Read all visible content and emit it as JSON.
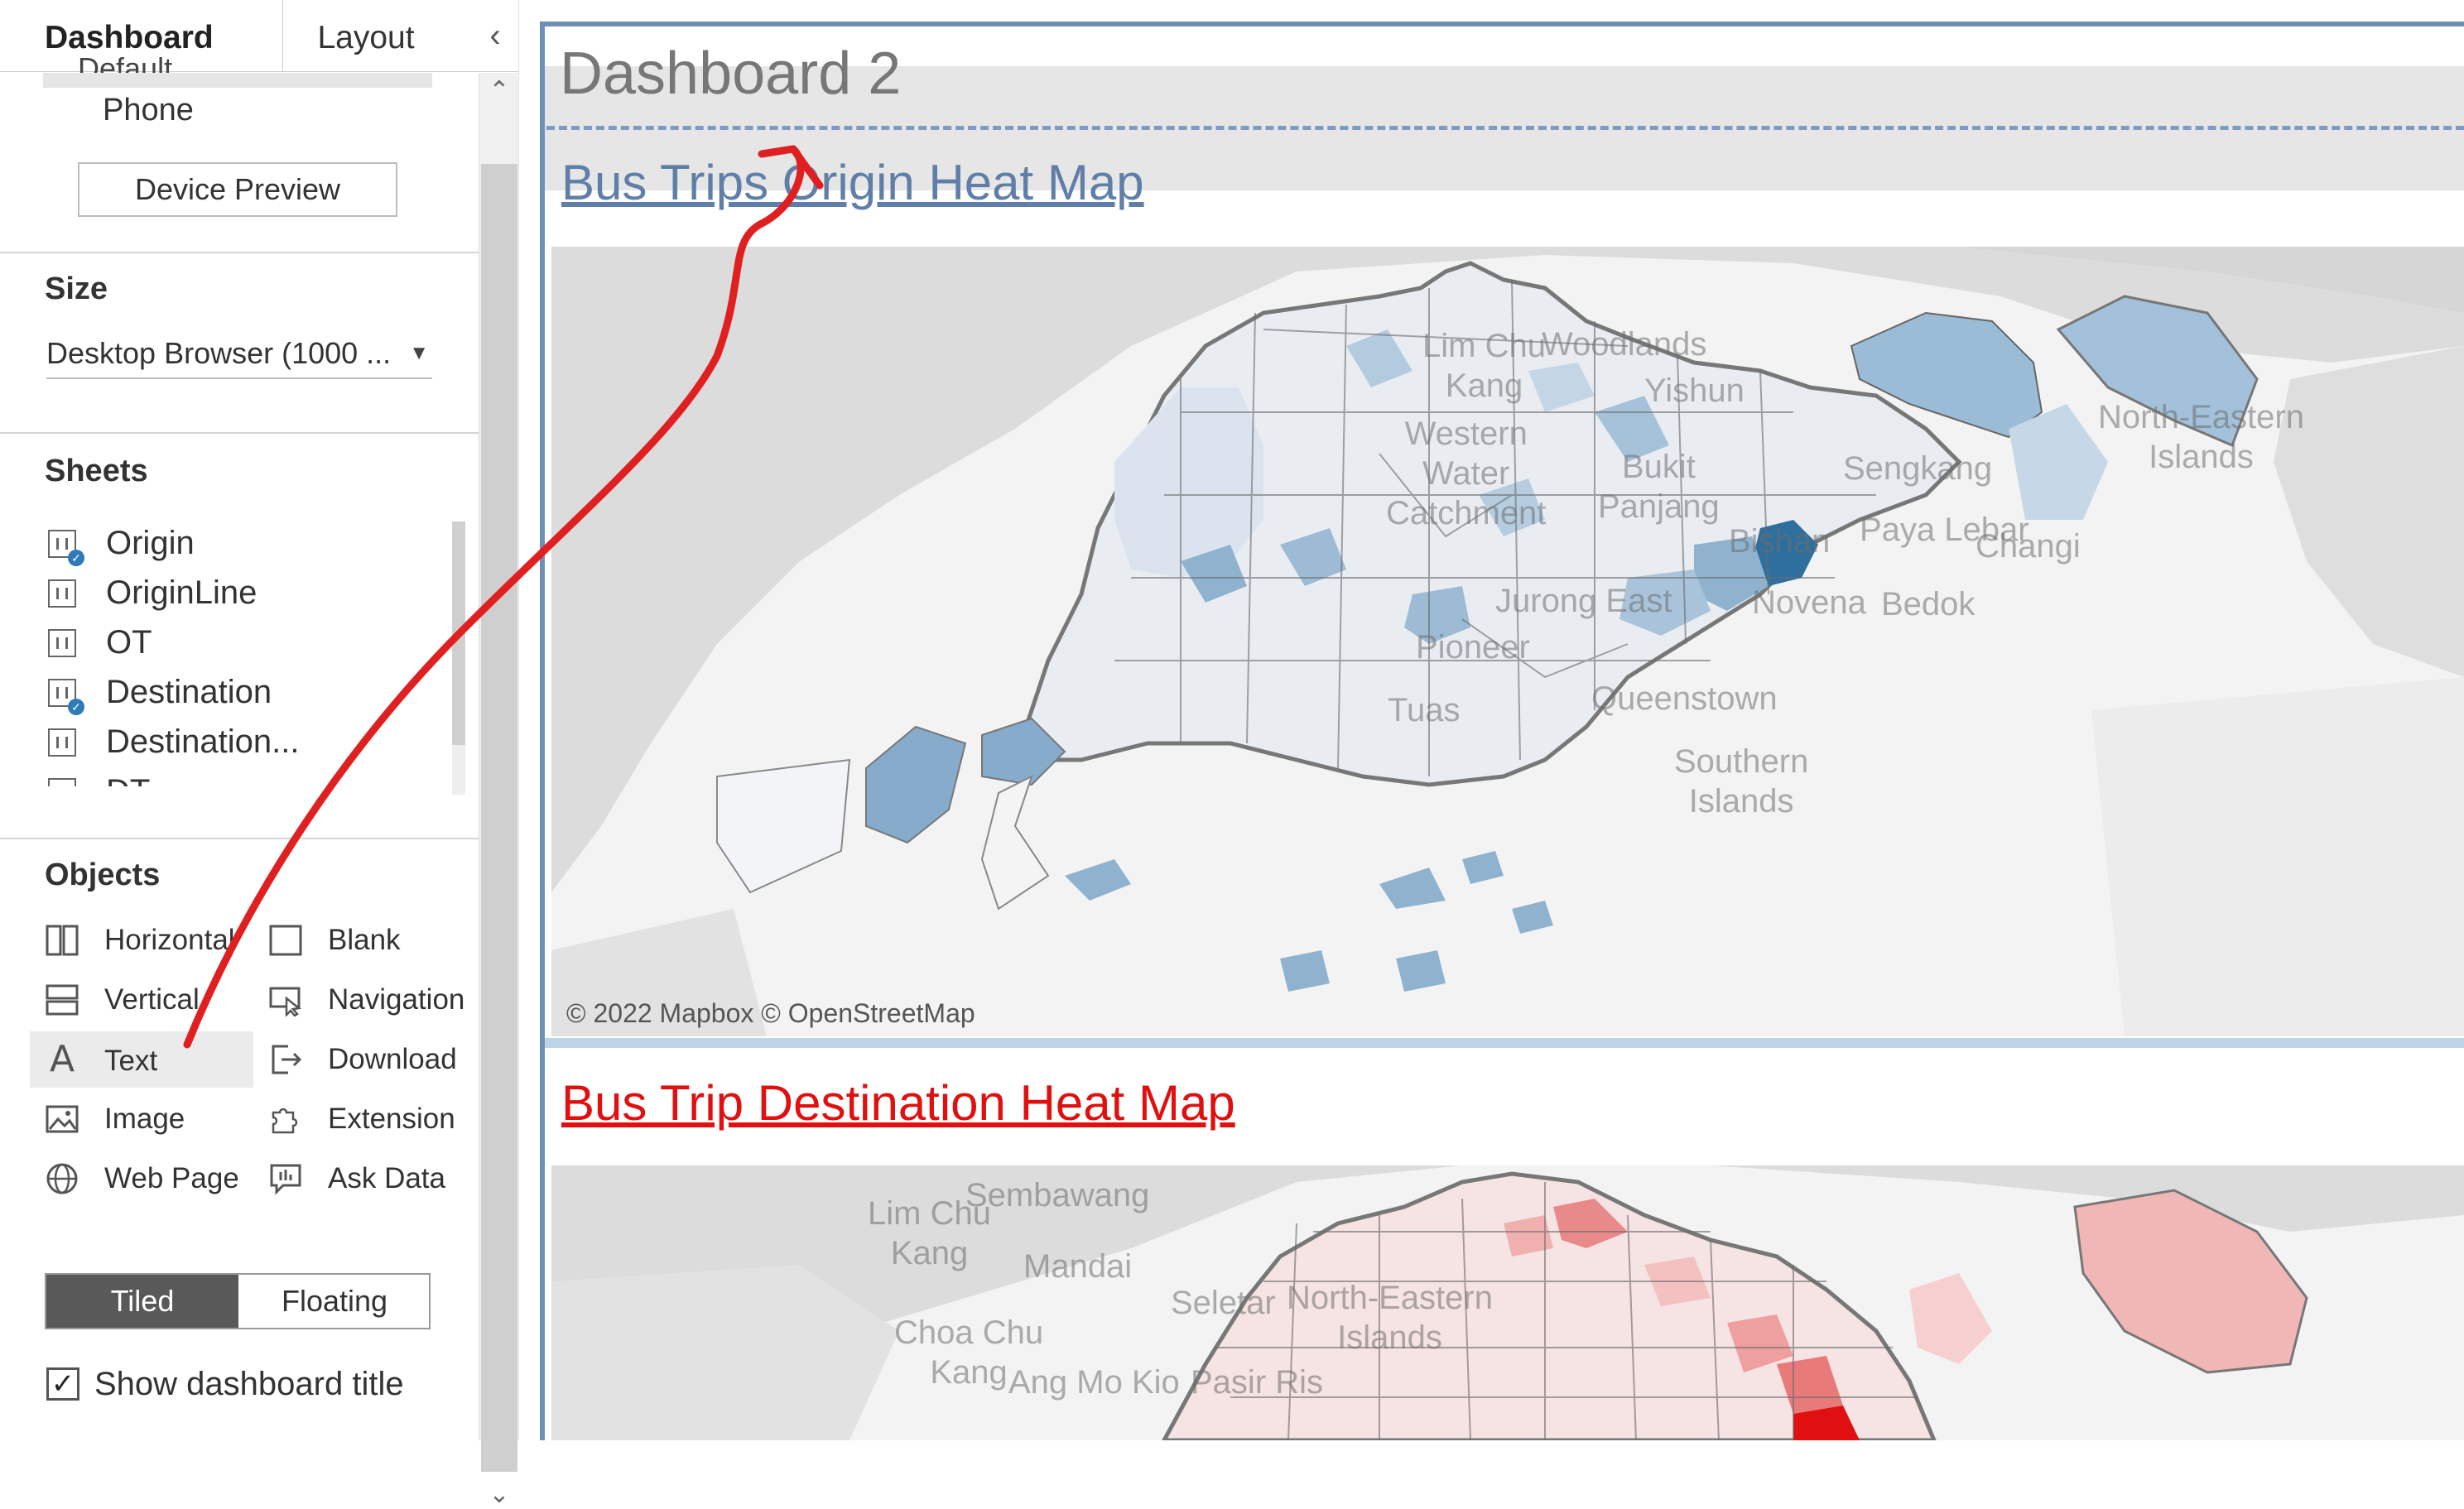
{
  "tabs": {
    "dashboard": "Dashboard",
    "layout": "Layout",
    "collapse_icon": "‹"
  },
  "device": {
    "default_partial": "Default",
    "phone": "Phone",
    "preview_button": "Device Preview"
  },
  "size": {
    "title": "Size",
    "value": "Desktop Browser (1000 ..."
  },
  "sheets": {
    "title": "Sheets",
    "items": [
      {
        "label": "Origin",
        "used": true
      },
      {
        "label": "OriginLine",
        "used": false
      },
      {
        "label": "OT",
        "used": false
      },
      {
        "label": "Destination",
        "used": true
      },
      {
        "label": "Destination...",
        "used": false
      },
      {
        "label": "DT",
        "used": false
      }
    ]
  },
  "objects": {
    "title": "Objects",
    "horizontal": "Horizontal",
    "blank": "Blank",
    "vertical": "Vertical",
    "navigation": "Navigation",
    "text": "Text",
    "download": "Download",
    "image": "Image",
    "extension": "Extension",
    "web_page": "Web Page",
    "ask_data": "Ask Data"
  },
  "layout_mode": {
    "tiled": "Tiled",
    "floating": "Floating",
    "selected": "Tiled"
  },
  "show_title": {
    "label": "Show dashboard title",
    "checked": true,
    "mark": "✓"
  },
  "dashboard": {
    "title": "Dashboard 2",
    "origin_title": "Bus Trips Origin Heat Map",
    "destination_title": "Bus Trip Destination Heat Map",
    "map_credit": "© 2022 Mapbox © OpenStreetMap"
  },
  "map_labels_origin": {
    "lim_chu_kang": "Lim Chu\nKang",
    "woodlands": "Woodlands",
    "yishun": "Yishun",
    "western_water": "Western\nWater\nCatchment",
    "sengkang": "Sengkang",
    "bukit_panjang": "Bukit\nPanjang",
    "bishan": "Bishan",
    "paya_lebar": "Paya Lebar",
    "changi": "Changi",
    "jurong_east": "Jurong East",
    "novena": "Novena",
    "bedok": "Bedok",
    "pioneer": "Pioneer",
    "queenstown": "Queenstown",
    "tuas": "Tuas",
    "southern_islands": "Southern\nIslands",
    "ne_islands": "North-Eastern\nIslands"
  },
  "map_labels_dest": {
    "lim_chu_kang": "Lim Chu\nKang",
    "sembawang": "Sembawang",
    "mandai": "Mandai",
    "seletar": "Seletar",
    "choa_chu_kang": "Choa Chu\nKang",
    "ang_mo_kio": "Ang Mo Kio",
    "pasir_ris": "Pasir Ris",
    "ne_islands": "North-Eastern\nIslands"
  },
  "colors": {
    "origin_accent": "#2f6f9e",
    "destination_accent": "#e01010",
    "frame": "#6f8fb4",
    "annotation_arrow": "#e02020"
  },
  "icons": {
    "sheet": "worksheet-icon",
    "used": "check-circle-icon",
    "horizontal": "horizontal-container-icon",
    "vertical": "vertical-container-icon",
    "text": "text-icon",
    "image": "image-icon",
    "web_page": "globe-icon",
    "blank": "blank-icon",
    "navigation": "navigation-icon",
    "download": "download-icon",
    "extension": "extension-puzzle-icon",
    "ask_data": "ask-data-icon"
  }
}
